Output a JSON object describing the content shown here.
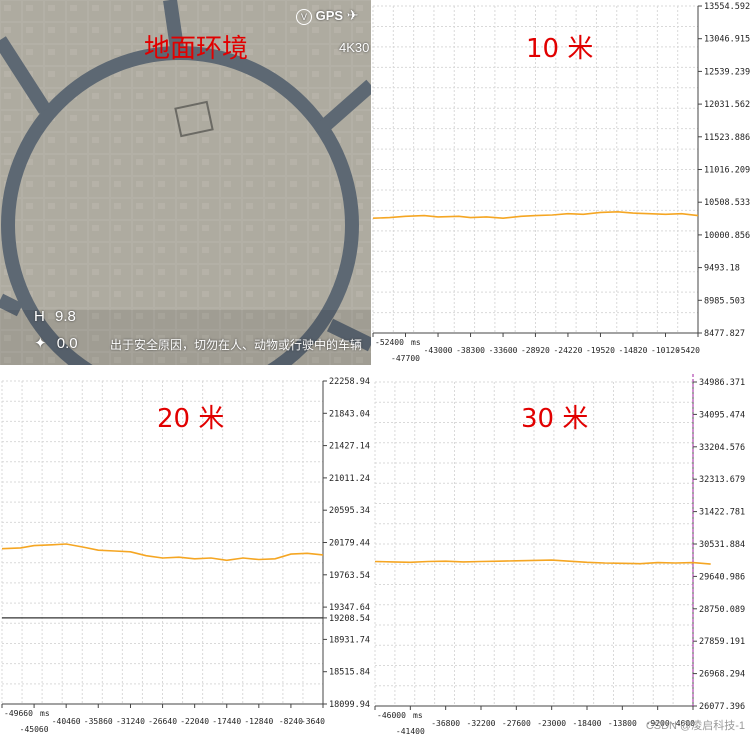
{
  "camera": {
    "title": "地面环境",
    "gps_label": "GPS",
    "mode_label": "4K30",
    "height_label": "H",
    "height_value": "9.8",
    "speed_value": "0.0",
    "notice": "出于安全原因，切勿在人、动物或行驶中的车辆"
  },
  "watermark": "CSDN @凌启科技-1",
  "chart_data": [
    {
      "type": "line",
      "title": "10 米",
      "x_unit": "ms",
      "x_ticks": [
        "-52400",
        "-47700",
        "-43000",
        "-38300",
        "-33600",
        "-28920",
        "-24220",
        "-19520",
        "-14820",
        "-10120",
        "-5420"
      ],
      "y_ticks": [
        "13554.592",
        "13046.915",
        "12539.239",
        "12031.562",
        "11523.886",
        "11016.209",
        "10508.533",
        "10000.856",
        "9493.18",
        "8985.503",
        "8477.827"
      ],
      "ylim": [
        8477.827,
        13554.592
      ],
      "grid": true,
      "series": [
        {
          "color": "#f5a623",
          "x": [
            -52400,
            -50000,
            -47700,
            -45000,
            -43000,
            -40000,
            -38300,
            -36000,
            -33600,
            -31000,
            -28920,
            -26500,
            -24220,
            -22000,
            -19520,
            -17000,
            -14820,
            -12500,
            -10120,
            -7800,
            -5420
          ],
          "values": [
            10260,
            10270,
            10290,
            10300,
            10280,
            10290,
            10270,
            10280,
            10260,
            10290,
            10300,
            10310,
            10330,
            10320,
            10350,
            10360,
            10340,
            10330,
            10320,
            10330,
            10300
          ]
        }
      ]
    },
    {
      "type": "line",
      "title": "20 米",
      "x_unit": "ms",
      "x_ticks": [
        "-49660",
        "-45060",
        "-40460",
        "-35860",
        "-31240",
        "-26640",
        "-22040",
        "-17440",
        "-12840",
        "-8240",
        "-3640"
      ],
      "y_ticks": [
        "22258.945",
        "21843.045",
        "21427.145",
        "21011.245",
        "20595.345",
        "20179.445",
        "19763.545",
        "19347.645",
        "19208.541",
        "18931.745",
        "18515.845",
        "18099.945"
      ],
      "ylim": [
        18099.945,
        22258.945
      ],
      "grid": true,
      "series": [
        {
          "color": "#f5a623",
          "x": [
            -49660,
            -47000,
            -45060,
            -42500,
            -40460,
            -38000,
            -35860,
            -33500,
            -31240,
            -29000,
            -26640,
            -24300,
            -22040,
            -19700,
            -17440,
            -15100,
            -12840,
            -10500,
            -8240,
            -5900,
            -3640
          ],
          "values": [
            20100,
            20110,
            20140,
            20150,
            20160,
            20120,
            20080,
            20070,
            20060,
            20010,
            19980,
            19990,
            19970,
            19980,
            19950,
            19980,
            19960,
            19970,
            20030,
            20040,
            20020
          ]
        },
        {
          "color": "#333333",
          "x": [
            -49660,
            -3640
          ],
          "values": [
            19208.541,
            19208.541
          ]
        }
      ]
    },
    {
      "type": "line",
      "title": "30 米",
      "x_unit": "ms",
      "x_ticks": [
        "-46000",
        "-41400",
        "-36800",
        "-32200",
        "-27600",
        "-23000",
        "-18400",
        "-13800",
        "-9200",
        "-4600"
      ],
      "y_ticks": [
        "34986.371",
        "34095.474",
        "33204.576",
        "32313.679",
        "31422.781",
        "30531.884",
        "29640.986",
        "28750.089",
        "27859.191",
        "26968.294",
        "26077.396"
      ],
      "ylim": [
        26077.396,
        34986.371
      ],
      "grid": true,
      "series": [
        {
          "color": "#f5a623",
          "x": [
            -46000,
            -43700,
            -41400,
            -39100,
            -36800,
            -34500,
            -32200,
            -29900,
            -27600,
            -25300,
            -23000,
            -20700,
            -18400,
            -16100,
            -13800,
            -11500,
            -9200,
            -6900,
            -4600,
            -2300
          ],
          "values": [
            30050,
            30040,
            30030,
            30050,
            30060,
            30040,
            30050,
            30060,
            30070,
            30080,
            30090,
            30060,
            30030,
            30010,
            30000,
            29990,
            30020,
            30010,
            30020,
            29980
          ]
        }
      ]
    }
  ]
}
